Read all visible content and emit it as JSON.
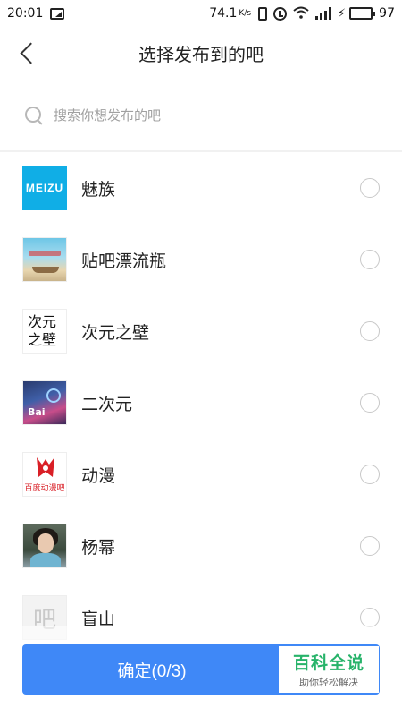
{
  "status_bar": {
    "time": "20:01",
    "net_speed": "74.1",
    "net_unit": "K/s",
    "battery_level": "97",
    "battery_color": "#2fbf2f"
  },
  "header": {
    "title": "选择发布到的吧"
  },
  "search": {
    "placeholder": "搜索你想发布的吧"
  },
  "bars": [
    {
      "name": "魅族",
      "thumb_text": "MEIZU",
      "selected": false
    },
    {
      "name": "贴吧漂流瓶",
      "selected": false
    },
    {
      "name": "次元之壁",
      "thumb_text_1": "次元",
      "thumb_text_2": "之壁",
      "selected": false
    },
    {
      "name": "二次元",
      "thumb_text": "Bai",
      "selected": false
    },
    {
      "name": "动漫",
      "thumb_text": "百度动漫吧",
      "selected": false
    },
    {
      "name": "杨幂",
      "selected": false
    },
    {
      "name": "盲山",
      "thumb_text": "吧",
      "selected": false
    }
  ],
  "confirm": {
    "label": "确定(0/3)",
    "accent_color": "#3f88f7"
  },
  "watermark": {
    "title": "百科全说",
    "subtitle": "助你轻松解决"
  }
}
